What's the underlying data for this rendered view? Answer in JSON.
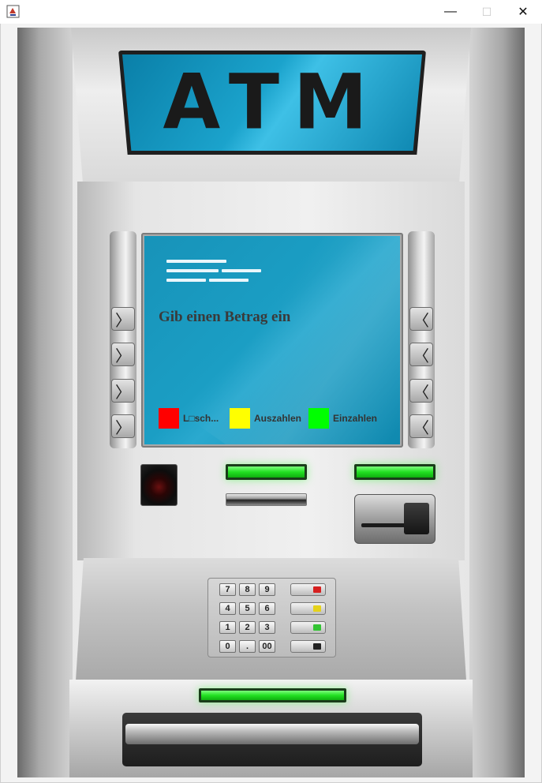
{
  "window": {
    "icon": "java-app-icon",
    "minimize_glyph": "—",
    "maximize_glyph": "☐",
    "close_glyph": "✕"
  },
  "sign": {
    "text": "ATM"
  },
  "screen": {
    "prompt": "Gib einen Betrag ein",
    "actions": [
      {
        "label": "L□sch...",
        "color": "#ff0000"
      },
      {
        "label": "Auszahlen",
        "color": "#ffff00"
      },
      {
        "label": "Einzahlen",
        "color": "#00ff00"
      }
    ]
  },
  "side_keys": {
    "left_glyph": "〉",
    "right_glyph": "〈"
  },
  "keypad": {
    "keys": [
      "7",
      "8",
      "9",
      "4",
      "5",
      "6",
      "1",
      "2",
      "3",
      "0",
      ".",
      "00"
    ],
    "function_key_colors": [
      "#d62020",
      "#e5d21a",
      "#33c433",
      "#222222"
    ]
  },
  "colors": {
    "screen_blue": "#1b9ec4",
    "indicator_green": "#22e022"
  }
}
